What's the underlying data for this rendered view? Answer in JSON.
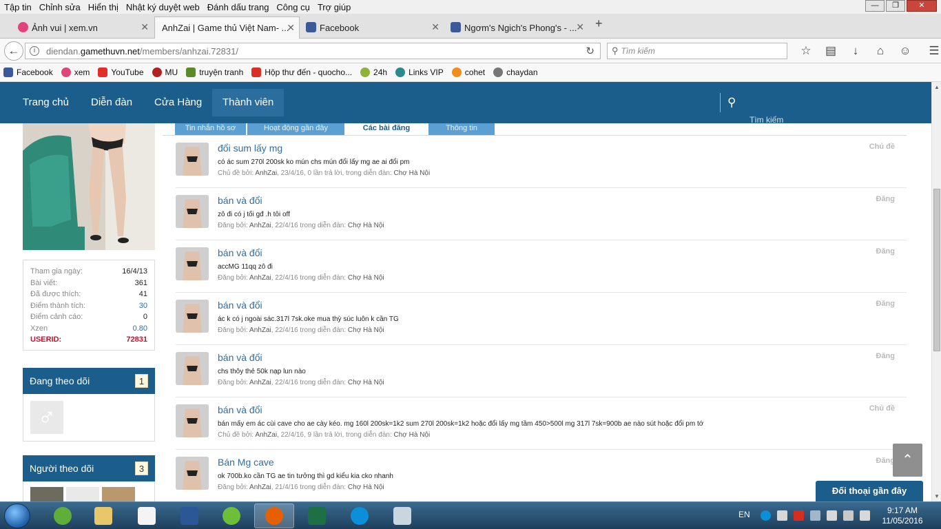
{
  "browser": {
    "menu": [
      "Tập tin",
      "Chỉnh sửa",
      "Hiển thị",
      "Nhật ký duyệt web",
      "Đánh dấu trang",
      "Công cụ",
      "Trợ giúp"
    ],
    "tabs": [
      {
        "label": "Ảnh vui | xem.vn"
      },
      {
        "label": "AnhZai | Game thủ Việt Nam- ..."
      },
      {
        "label": "Facebook"
      },
      {
        "label": "Ngơm's Ngich's Phong's - ..."
      }
    ],
    "url_prefix": "diendan.",
    "url_domain": "gamethuvn.net",
    "url_path": "/members/anhzai.72831/",
    "search_placeholder": "Tìm kiếm",
    "bookmarks": [
      {
        "label": "Facebook",
        "color": "#3b5998"
      },
      {
        "label": "xem",
        "color": "#e0447a"
      },
      {
        "label": "YouTube",
        "color": "#e52d27"
      },
      {
        "label": "MU",
        "color": "#b22222"
      },
      {
        "label": "truyện tranh",
        "color": "#5a8a2a"
      },
      {
        "label": "Hộp thư đến - quocho...",
        "color": "#d93025"
      },
      {
        "label": "24h",
        "color": "#8fb339"
      },
      {
        "label": "Links VIP",
        "color": "#2b8a8a"
      },
      {
        "label": "cohet",
        "color": "#f28c1b"
      },
      {
        "label": "chaydan",
        "color": "#777777"
      }
    ]
  },
  "site": {
    "nav": [
      "Trang chủ",
      "Diễn đàn",
      "Cửa Hàng",
      "Thành viên"
    ],
    "search_label": "Tìm kiếm",
    "profile_tabs": [
      "Tin nhắn hồ sơ",
      "Hoạt động gần đây",
      "Các bài đăng",
      "Thông tin"
    ],
    "stats": [
      {
        "k": "Tham gia ngày:",
        "v": "16/4/13"
      },
      {
        "k": "Bài viết:",
        "v": "361"
      },
      {
        "k": "Đã được thích:",
        "v": "41"
      },
      {
        "k": "Điểm thành tích:",
        "v": "30"
      },
      {
        "k": "Điểm cảnh cáo:",
        "v": "0"
      },
      {
        "k": "Xzen",
        "v": "0.80"
      },
      {
        "k": "USERID:",
        "v": "72831"
      }
    ],
    "following": {
      "label": "Đang theo dõi",
      "count": "1"
    },
    "followers": {
      "label": "Người theo dõi",
      "count": "3"
    },
    "posts": [
      {
        "title": "đổi sum lấy mg",
        "snippet": "có ác sum 270l 200sk ko mún chs mún đổi lấy mg ae ai đổi pm",
        "meta_pre": "Chủ đề bởi: ",
        "author": "AnhZai",
        "meta_mid": ", 23/4/16, 0 lần trả lời, trong diễn đàn: ",
        "forum": "Chợ Hà Nội",
        "type": "Chủ đề"
      },
      {
        "title": "bán và đổi",
        "snippet": "zô đi có j tối gđ .h tôi off",
        "meta_pre": "Đăng bởi: ",
        "author": "AnhZai",
        "meta_mid": ", 22/4/16 trong diễn đàn: ",
        "forum": "Chợ Hà Nội",
        "type": "Đăng"
      },
      {
        "title": "bán và đổi",
        "snippet": "accMG 11qq zô đi",
        "meta_pre": "Đăng bởi: ",
        "author": "AnhZai",
        "meta_mid": ", 22/4/16 trong diễn đàn: ",
        "forum": "Chợ Hà Nội",
        "type": "Đăng"
      },
      {
        "title": "bán và đổi",
        "snippet": "ác k có j ngoài sác.317l 7sk.oke mua thỳ súc luôn k cần TG",
        "meta_pre": "Đăng bởi: ",
        "author": "AnhZai",
        "meta_mid": ", 22/4/16 trong diễn đàn: ",
        "forum": "Chợ Hà Nội",
        "type": "Đăng"
      },
      {
        "title": "bán và đổi",
        "snippet": "chs thôy thẻ 50k nạp lun nào",
        "meta_pre": "Đăng bởi: ",
        "author": "AnhZai",
        "meta_mid": ", 22/4/16 trong diễn đàn: ",
        "forum": "Chợ Hà Nội",
        "type": "Đăng"
      },
      {
        "title": "bán và đổi",
        "snippet": "bán mấy em ác cùi cave cho ae cày kéo. mg 160l 200sk=1k2 sum 270l 200sk=1k2 hoặc đổi lấy mg tầm 450>500l mg 317l 7sk=900b ae nào sút hoặc đổi pm tớ",
        "meta_pre": "Chủ đề bởi: ",
        "author": "AnhZai",
        "meta_mid": ", 22/4/16, 9 lần trả lời, trong diễn đàn: ",
        "forum": "Chợ Hà Nội",
        "type": "Chủ đề"
      },
      {
        "title": "Bán Mg cave",
        "snippet": "ok 700b.ko cần TG ae tin tưởng thì gd kiểu kia cko nhanh",
        "meta_pre": "Đăng bởi: ",
        "author": "AnhZai",
        "meta_mid": ", 21/4/16 trong diễn đàn: ",
        "forum": "Chợ Hà Nội",
        "type": "Đăng"
      }
    ],
    "chat_label": "Đối thoại gần đây"
  },
  "taskbar": {
    "lang": "EN",
    "time": "9:17 AM",
    "date": "11/05/2016"
  }
}
